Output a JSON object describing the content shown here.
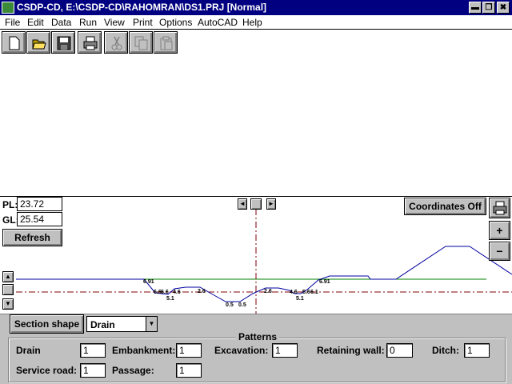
{
  "window": {
    "title": "CSDP-CD, E:\\CSDP-CD\\RAHOMRAN\\DS1.PRJ [Normal]",
    "controls": [
      "▬",
      "❐",
      "✖"
    ]
  },
  "menu": [
    "File",
    "Edit",
    "Data",
    "Run",
    "View",
    "Print",
    "Options",
    "AutoCAD",
    "Help"
  ],
  "toolbar": {
    "icons": [
      "new-file-icon",
      "open-folder-icon",
      "save-disk-icon",
      "print-icon",
      "cut-scissors-icon",
      "copy-icon",
      "paste-icon"
    ]
  },
  "section": {
    "pl_label": "PL:",
    "pl_value": "23.72",
    "gl_label": "GL:",
    "gl_value": "25.54",
    "refresh_label": "Refresh",
    "coords_label": "Coordinates Off",
    "zoom_in": "+",
    "zoom_out": "−",
    "scroll_left": "◄",
    "scroll_right": "►",
    "scroll_up": "▲",
    "scroll_down": "▼",
    "profile_labels": [
      "6.91",
      "6.6",
      "6.6",
      "4.6",
      "5.1",
      "2.6",
      "0.5",
      "0.5",
      "2.6",
      "4.6",
      "5.1",
      "5.6",
      "6.1",
      "6.91"
    ],
    "colors": {
      "profile": "#0000a0",
      "grade_line": "#008000",
      "center_line": "#800000"
    }
  },
  "section_shape": {
    "button_label": "Section shape",
    "selected": "Drain"
  },
  "patterns": {
    "title": "Patterns",
    "drain_label": "Drain",
    "drain_value": "1",
    "embankment_label": "Embankment:",
    "embankment_value": "1",
    "excavation_label": "Excavation:",
    "excavation_value": "1",
    "retaining_label": "Retaining wall:",
    "retaining_value": "0",
    "ditch_label": "Ditch:",
    "ditch_value": "1",
    "service_label": "Service road:",
    "service_value": "1",
    "passage_label": "Passage:",
    "passage_value": "1"
  }
}
